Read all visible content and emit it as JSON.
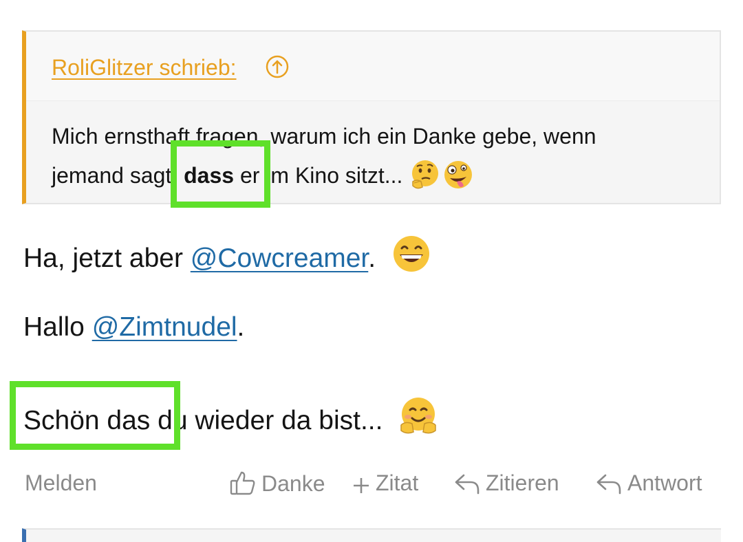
{
  "quote": {
    "author": "RoliGlitzer schrieb:",
    "line1": "Mich ernsthaft fragen, warum ich ein Danke gebe, wenn",
    "line2_pre": "jemand sagt",
    "line2_bold": ", dass",
    "line2_post": " er im Kino sitzt...",
    "emoji1": "thinking-face-emoji",
    "emoji2": "zany-face-emoji"
  },
  "post": {
    "line1_pre": "Ha, jetzt aber ",
    "line1_mention": "@Cowcreamer",
    "line1_post": ".",
    "line1_emoji": "grinning-face-emoji",
    "line2_pre": "Hallo ",
    "line2_mention": "@Zimtnudel",
    "line2_post": ".",
    "line3_text": "Schön das du wieder da bist...",
    "line3_emoji": "hugging-face-emoji"
  },
  "actions": {
    "report": "Melden",
    "thanks": "Danke",
    "quote_add": "Zitat",
    "quote": "Zitieren",
    "reply": "Antwort"
  },
  "colors": {
    "quote_accent": "#e8a020",
    "mention": "#1f6aa5",
    "highlight": "#5fe02a",
    "muted": "#8a8a8a"
  }
}
